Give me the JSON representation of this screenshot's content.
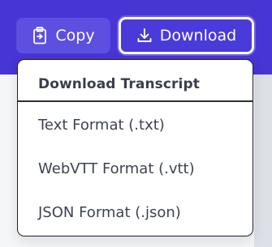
{
  "toolbar": {
    "copy_label": "Copy",
    "download_label": "Download",
    "copy_icon": "clipboard-icon",
    "download_icon": "download-icon"
  },
  "dropdown": {
    "title": "Download Transcript",
    "items": [
      {
        "label": "Text Format (.txt)"
      },
      {
        "label": "WebVTT Format (.vtt)"
      },
      {
        "label": "JSON Format (.json)"
      }
    ]
  },
  "colors": {
    "accent": "#4735d4",
    "button_fill": "#5d4fe0",
    "text": "#3d4350"
  }
}
